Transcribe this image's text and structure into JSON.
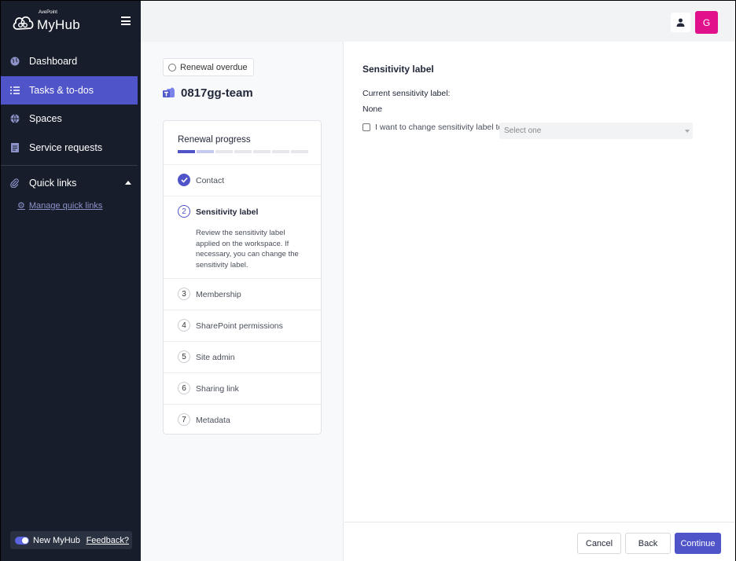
{
  "sidebar": {
    "brand_small": "AvePoint",
    "brand_main": "MyHub",
    "items": [
      {
        "label": "Dashboard",
        "icon": "globe-icon"
      },
      {
        "label": "Tasks & to-dos",
        "icon": "checklist-icon"
      },
      {
        "label": "Spaces",
        "icon": "globe-icon"
      },
      {
        "label": "Service requests",
        "icon": "document-icon"
      }
    ],
    "active_item": "Tasks & to-dos",
    "quick_links": "Quick links",
    "manage_quick_links": "Manage quick links",
    "new_myhub": "New MyHub",
    "feedback": "Feedback?"
  },
  "topbar": {
    "avatar_initial": "G",
    "avatar_color": "#e0118a"
  },
  "workspace": {
    "status": "Renewal overdue",
    "team_name": "0817gg-team"
  },
  "progress": {
    "title": "Renewal progress",
    "completed_fraction": 0.125,
    "steps": [
      {
        "number": "1",
        "label": "Contact",
        "state": "done"
      },
      {
        "number": "2",
        "label": "Sensitivity label",
        "state": "current",
        "description": "Review the sensitivity label applied on the workspace. If necessary, you can change the sensitivity label."
      },
      {
        "number": "3",
        "label": "Membership",
        "state": "pending"
      },
      {
        "number": "4",
        "label": "SharePoint permissions",
        "state": "pending"
      },
      {
        "number": "5",
        "label": "Site admin",
        "state": "pending"
      },
      {
        "number": "6",
        "label": "Sharing link",
        "state": "pending"
      },
      {
        "number": "7",
        "label": "Metadata",
        "state": "pending"
      }
    ]
  },
  "main": {
    "section_title": "Sensitivity label",
    "current_label_title": "Current sensitivity label:",
    "current_label_value": "None",
    "change_checkbox_label": "I want to change sensitivity label to",
    "select_placeholder": "Select one"
  },
  "footer": {
    "cancel": "Cancel",
    "back": "Back",
    "continue": "Continue"
  },
  "colors": {
    "accent": "#5054c9",
    "sidebar_bg": "#171d2a"
  }
}
